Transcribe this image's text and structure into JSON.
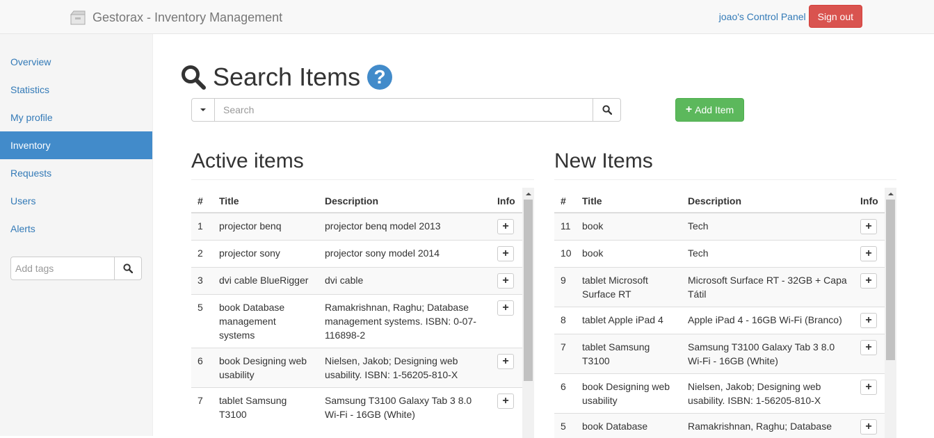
{
  "app": {
    "brand": "Gestorax - Inventory Management",
    "control_panel": "joao's Control Panel",
    "sign_out": "Sign out"
  },
  "sidebar": {
    "items": [
      {
        "label": "Overview"
      },
      {
        "label": "Statistics"
      },
      {
        "label": "My profile"
      },
      {
        "label": "Inventory",
        "active": true
      },
      {
        "label": "Requests"
      },
      {
        "label": "Users"
      },
      {
        "label": "Alerts"
      }
    ],
    "tags_placeholder": "Add tags"
  },
  "page": {
    "title": "Search Items",
    "help_symbol": "?",
    "search_placeholder": "Search",
    "add_item": "Add Item",
    "add_item_icon": "+"
  },
  "active_items": {
    "title": "Active items",
    "columns": [
      "#",
      "Title",
      "Description",
      "Info"
    ],
    "rows": [
      {
        "num": "1",
        "title": "projector benq",
        "description": "projector benq model 2013"
      },
      {
        "num": "2",
        "title": "projector sony",
        "description": "projector sony model 2014"
      },
      {
        "num": "3",
        "title": "dvi cable BlueRigger",
        "description": "dvi cable"
      },
      {
        "num": "5",
        "title": "book Database management systems",
        "description": "Ramakrishnan, Raghu; Database management systems. ISBN: 0-07-116898-2"
      },
      {
        "num": "6",
        "title": "book Designing web usability",
        "description": "Nielsen, Jakob; Designing web usability. ISBN: 1-56205-810-X"
      },
      {
        "num": "7",
        "title": "tablet Samsung T3100",
        "description": "Samsung T3100 Galaxy Tab 3 8.0 Wi-Fi - 16GB (White)"
      }
    ]
  },
  "new_items": {
    "title": "New Items",
    "columns": [
      "#",
      "Title",
      "Description",
      "Info"
    ],
    "rows": [
      {
        "num": "11",
        "title": "book",
        "description": "Tech"
      },
      {
        "num": "10",
        "title": "book",
        "description": "Tech"
      },
      {
        "num": "9",
        "title": "tablet Microsoft Surface RT",
        "description": "Microsoft Surface RT - 32GB + Capa Tátil"
      },
      {
        "num": "8",
        "title": "tablet Apple iPad 4",
        "description": "Apple iPad 4 - 16GB Wi-Fi (Branco)"
      },
      {
        "num": "7",
        "title": "tablet Samsung T3100",
        "description": "Samsung T3100 Galaxy Tab 3 8.0 Wi-Fi - 16GB (White)"
      },
      {
        "num": "6",
        "title": "book Designing web usability",
        "description": "Nielsen, Jakob; Designing web usability. ISBN: 1-56205-810-X"
      },
      {
        "num": "5",
        "title": "book Database",
        "description": "Ramakrishnan, Raghu; Database"
      }
    ]
  },
  "info_symbol": "+",
  "colors": {
    "link": "#337ab7",
    "active_nav": "#428bca",
    "danger": "#d9534f",
    "success": "#5cb85c"
  }
}
